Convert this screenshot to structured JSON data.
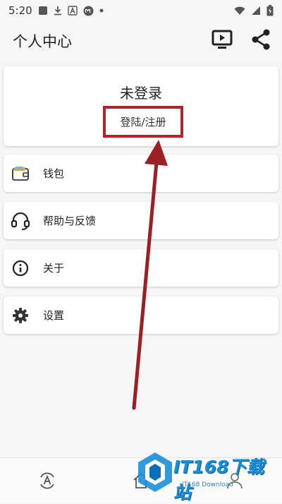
{
  "status_bar": {
    "time": "5:20",
    "icons": [
      "notification-box-icon",
      "download-icon",
      "a-box-icon",
      "m-circle-icon",
      "dot-icon",
      "wifi-icon",
      "battery-icon"
    ]
  },
  "app_bar": {
    "title": "个人中心",
    "actions": [
      "tv-play-icon",
      "share-icon"
    ]
  },
  "profile": {
    "name": "未登录",
    "login_label": "登陆/注册"
  },
  "menu": [
    {
      "icon": "wallet-icon",
      "label": "钱包"
    },
    {
      "icon": "headset-icon",
      "label": "帮助与反馈"
    },
    {
      "icon": "info-icon",
      "label": "关于"
    },
    {
      "icon": "gear-icon",
      "label": "设置"
    }
  ],
  "bottom_nav": [
    "app-store-icon",
    "home-icon",
    "user-icon"
  ],
  "watermark": {
    "title": "IT168下载站",
    "subtitle": "IT168 Download"
  },
  "colors": {
    "highlight": "#b3242a",
    "background": "#f6f6f6",
    "card": "#ffffff",
    "watermark": "#1a8fd9"
  }
}
